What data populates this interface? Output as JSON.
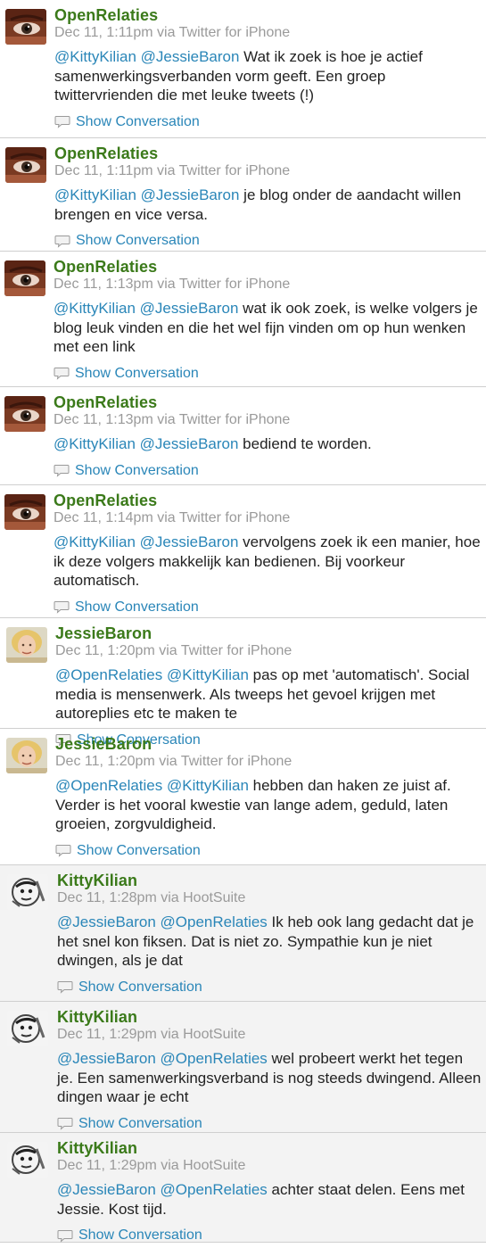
{
  "conversation_label": "Show Conversation",
  "tweets": [
    {
      "author": "OpenRelaties",
      "meta": "Dec 11, 1:11pm via Twitter for iPhone",
      "m1": "@KittyKilian",
      "m2": "@JessieBaron",
      "text": " Wat ik zoek is hoe je actief samenwerkingsverbanden vorm geeft. Een groep twittervrienden die met leuke tweets (!)",
      "avatar": "eye"
    },
    {
      "author": "OpenRelaties",
      "meta": "Dec 11, 1:11pm via Twitter for iPhone",
      "m1": "@KittyKilian",
      "m2": "@JessieBaron",
      "text": " je blog onder de aandacht willen brengen en vice versa.",
      "avatar": "eye"
    },
    {
      "author": "OpenRelaties",
      "meta": "Dec 11, 1:13pm via Twitter for iPhone",
      "m1": "@KittyKilian",
      "m2": "@JessieBaron",
      "text": " wat ik ook zoek, is welke volgers je blog leuk vinden en die het wel fijn vinden om op hun wenken met een link",
      "avatar": "eye"
    },
    {
      "author": "OpenRelaties",
      "meta": "Dec 11, 1:13pm via Twitter for iPhone",
      "m1": "@KittyKilian",
      "m2": "@JessieBaron",
      "text": " bediend te worden.",
      "avatar": "eye"
    },
    {
      "author": "OpenRelaties",
      "meta": "Dec 11, 1:14pm via Twitter for iPhone",
      "m1": "@KittyKilian",
      "m2": "@JessieBaron",
      "text": " vervolgens zoek ik een manier, hoe ik deze volgers makkelijk kan bedienen. Bij voorkeur automatisch.",
      "avatar": "eye"
    },
    {
      "author": "JessieBaron",
      "meta": "Dec 11, 1:20pm via Twitter for iPhone",
      "m1": "@OpenRelaties",
      "m2": "@KittyKilian",
      "text": " pas op met 'automatisch'. Social media is mensenwerk. Als tweeps het gevoel krijgen met autoreplies etc te maken te",
      "avatar": "woman"
    },
    {
      "author": "JessieBaron",
      "meta": "Dec 11, 1:20pm via Twitter for iPhone",
      "m1": "@OpenRelaties",
      "m2": "@KittyKilian",
      "text": " hebben dan haken ze juist af. Verder is het vooral kwestie van lange adem, geduld, laten groeien, zorgvuldigheid.",
      "avatar": "woman"
    },
    {
      "author": "KittyKilian",
      "meta": "Dec 11, 1:28pm via HootSuite",
      "m1": "@JessieBaron",
      "m2": "@OpenRelaties",
      "text": " Ik heb ook lang gedacht dat je het snel kon fiksen. Dat is niet zo. Sympathie kun je niet dwingen, als je dat",
      "avatar": "sketch"
    },
    {
      "author": "KittyKilian",
      "meta": "Dec 11, 1:29pm via HootSuite",
      "m1": "@JessieBaron",
      "m2": "@OpenRelaties",
      "text": " wel probeert werkt het tegen je. Een samenwerkingsverband is nog steeds dwingend. Alleen dingen waar je echt",
      "avatar": "sketch"
    },
    {
      "author": "KittyKilian",
      "meta": "Dec 11, 1:29pm via HootSuite",
      "m1": "@JessieBaron",
      "m2": "@OpenRelaties",
      "text": " achter staat delen. Eens met Jessie. Kost tijd.",
      "avatar": "sketch"
    }
  ]
}
